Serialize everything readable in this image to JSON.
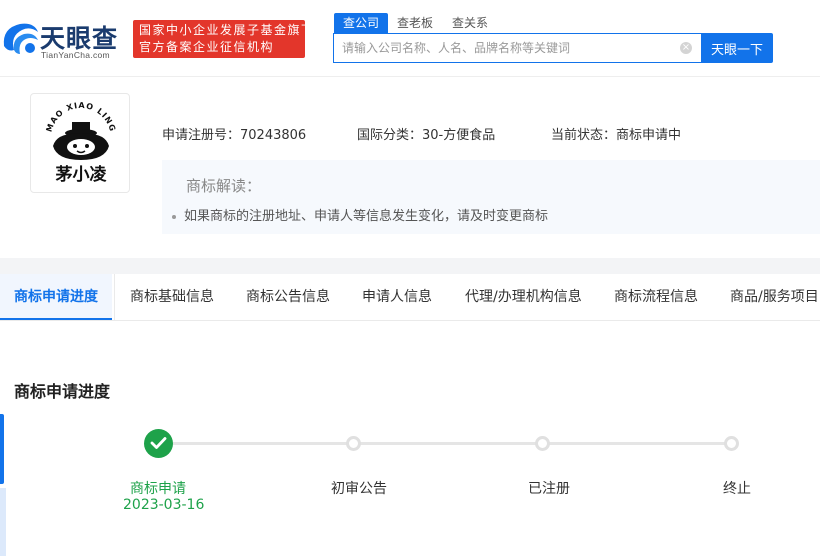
{
  "header": {
    "logo_text": "天眼查",
    "logo_sub": "TianYanCha.com",
    "badge_line1": "国家中小企业发展子基金旗下",
    "badge_line2": "官方备案企业征信机构",
    "search_tabs": [
      "查公司",
      "查老板",
      "查关系"
    ],
    "search_placeholder": "请输入公司名称、人名、品牌名称等关键词",
    "search_button": "天眼一下",
    "accent_color": "#1273ea",
    "badge_color": "#e3362b"
  },
  "trademark": {
    "image_text": "茅小凌",
    "image_arc_text": "MAO XIAO LING",
    "reg_no": "申请注册号：70243806",
    "intl_class": "国际分类：30-方便食品",
    "status": "当前状态：商标申请中",
    "interpretation_title": "商标解读：",
    "interpretation_items": [
      "如果商标的注册地址、申请人等信息发生变化，请及时变更商标"
    ]
  },
  "tabs": [
    "商标申请进度",
    "商标基础信息",
    "商标公告信息",
    "申请人信息",
    "代理/办理机构信息",
    "商标流程信息",
    "商品/服务项目"
  ],
  "progress": {
    "title": "商标申请进度",
    "steps": [
      {
        "label": "商标申请",
        "date": "2023-03-16",
        "done": true
      },
      {
        "label": "初审公告",
        "done": false
      },
      {
        "label": "已注册",
        "done": false
      },
      {
        "label": "终止",
        "done": false
      }
    ],
    "done_color": "#1ea24a"
  }
}
